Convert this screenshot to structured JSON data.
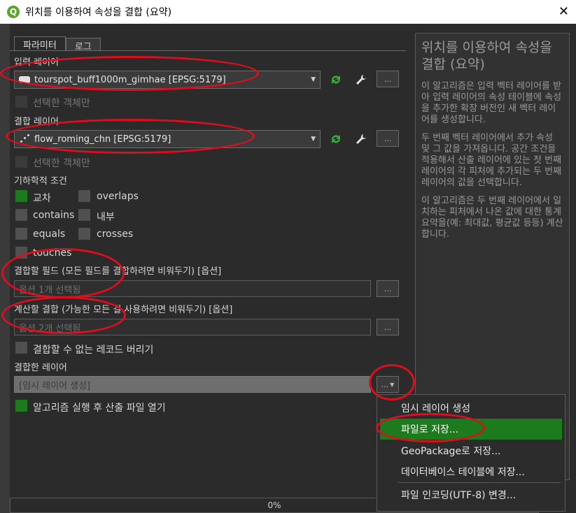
{
  "window": {
    "title": "위치를 이용하여 속성을 결합 (요약)",
    "logo": "Q"
  },
  "tabs": [
    {
      "label": "파라미터"
    },
    {
      "label": "로그"
    }
  ],
  "input_layer": {
    "label": "입력 레이어",
    "value": "tourspot_buff1000m_gimhae [EPSG:5179]",
    "selected_only": "선택한 객체만"
  },
  "join_layer": {
    "label": "결합 레이어",
    "value": "flow_roming_chn [EPSG:5179]",
    "selected_only": "선택한 객체만"
  },
  "geometry": {
    "label": "기하학적 조건",
    "options": [
      {
        "label": "교차",
        "checked": true
      },
      {
        "label": "overlaps",
        "checked": false
      },
      {
        "label": "contains",
        "checked": false
      },
      {
        "label": "내부",
        "checked": false
      },
      {
        "label": "equals",
        "checked": false
      },
      {
        "label": "crosses",
        "checked": false
      },
      {
        "label": "touches",
        "checked": false
      }
    ]
  },
  "fields_to_join": {
    "label": "결합할 필드 (모든 필드를 결합하려면 비워두기) [옵션]",
    "value": "옵션 1개 선택됨"
  },
  "summaries": {
    "label": "계산할 결합 (가능한 모든 걸 사용하려면 비워두기) [옵션]",
    "value": "옵션 2개 선택됨"
  },
  "discard": {
    "label": "결합할 수 없는 레코드 버리기"
  },
  "joined_layer": {
    "label": "결합한 레이어",
    "value": "[임시 레이어 생성]"
  },
  "open_after": {
    "label": "알고리즘 실행 후 산출 파일 열기"
  },
  "ellipsis": "...",
  "progress": {
    "text": "0%"
  },
  "help": {
    "title": "위치를 이용하여 속성을 결합 (요약)",
    "paragraphs": [
      "이 알고리즘은 입력 벡터 레이어를 받아 입력 레이어의 속성 테이블에 속성을 추가한 확장 버전인 새 벡터 레이어를 생성합니다.",
      "두 번째 벡터 레이어에서 추가 속성 및 그 값을 가져옵니다. 공간 조건을 적용해서 산출 레이어에 있는 첫 번째 레이어의 각 피처에 추가되는 두 번째 레이어의 값을 선택합니다.",
      "이 알고리즘은 두 번째 레이어에서 일치하는 피처에서 나온 값에 대한 통계 요약을(예: 최대값, 평균값 등등) 계산합니다."
    ]
  },
  "menu": {
    "items": [
      {
        "label": "임시 레이어 생성"
      },
      {
        "label": "파일로 저장..."
      },
      {
        "label": "GeoPackage로 저장..."
      },
      {
        "label": "데이터베이스 테이블에 저장..."
      },
      {
        "label": "파일 인코딩(UTF-8) 변경..."
      }
    ],
    "highlighted_index": 1
  },
  "colors": {
    "accent_green": "#1d7a1d",
    "annotation_red": "#e00d1d"
  }
}
